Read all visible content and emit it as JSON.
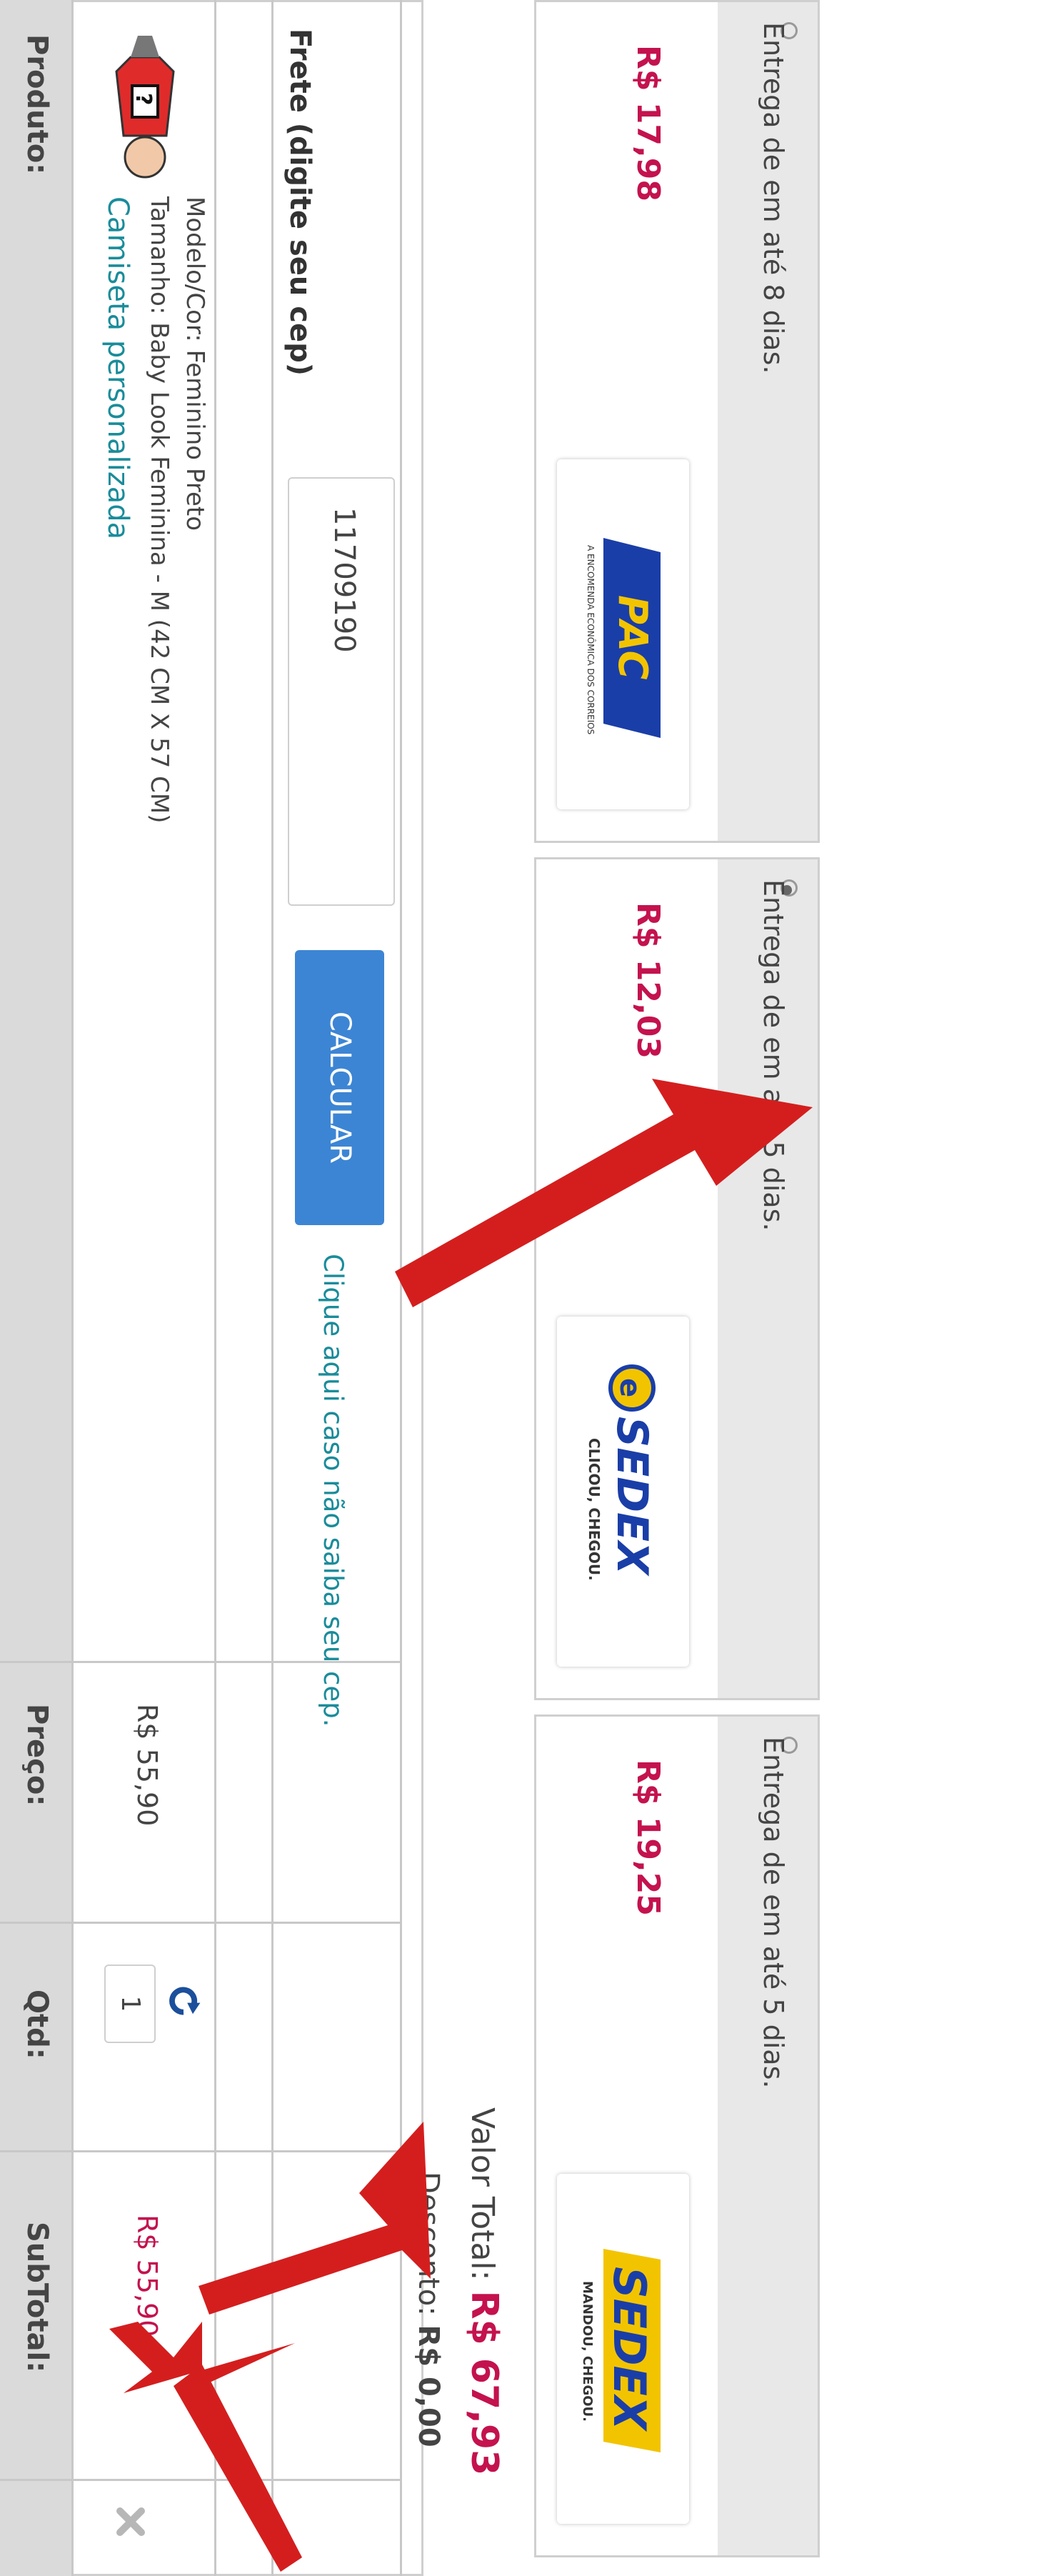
{
  "cart": {
    "headers": {
      "product": "Produto:",
      "price": "Preço:",
      "qty": "Qtd:",
      "subtotal": "SubTotal:"
    },
    "item": {
      "name": "Camiseta personalizada",
      "size_line": "Tamanho: Baby Look Feminina - M (42 CM X 57 CM)",
      "model_line": "Modelo/Cor: Feminino Preto",
      "price": "R$ 55,90",
      "qty": "1",
      "subtotal": "R$ 55,90",
      "refresh_icon": "refresh-icon",
      "remove_icon": "close-icon"
    }
  },
  "shipping": {
    "label": "Frete (digite seu cep)",
    "cep_value": "11709190",
    "calc_label": "CALCULAR",
    "help_link": "Clique aqui caso não saiba seu cep.",
    "options": [
      {
        "price": "R$ 17,98",
        "delivery": "Entrega de em até 8 dias.",
        "logo": "PAC",
        "logo_sub": "A ENCOMENDA ECONÔMICA DOS CORREIOS",
        "selected": false
      },
      {
        "price": "R$ 12,03",
        "delivery": "Entrega de em até 5 dias.",
        "logo": "SEDEX",
        "logo_sub": "CLICOU, CHEGOU.",
        "selected": true
      },
      {
        "price": "R$ 19,25",
        "delivery": "Entrega de em até 5 dias.",
        "logo": "SEDEX",
        "logo_sub": "MANDOU, CHEGOU.",
        "selected": false
      }
    ]
  },
  "totals": {
    "discount_label": "Desconto:",
    "discount_value": "R$ 0,00",
    "total_label": "Valor Total:",
    "total_value": "R$ 67,93"
  },
  "colors": {
    "accent_red": "#c4124e",
    "link_teal": "#1a8c9a",
    "button_blue": "#3c85d4",
    "arrow_red": "#d41e1e"
  }
}
